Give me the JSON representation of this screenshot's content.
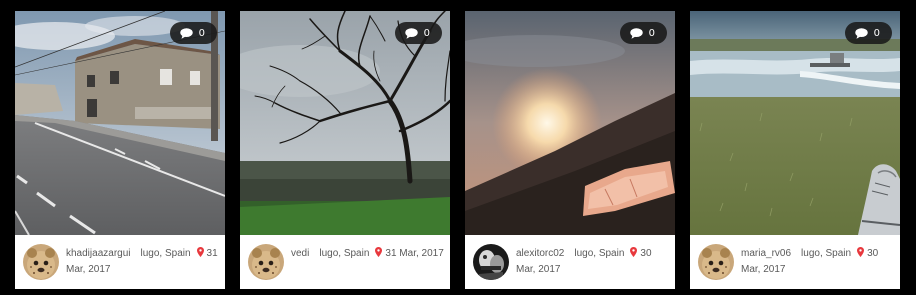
{
  "accent_color": "#e8383d",
  "posts": [
    {
      "comments": "0",
      "username": "khadijaazargui",
      "location": "lugo, Spain",
      "date": "31 Mar, 2017",
      "avatar": "cheetah-cub",
      "photo": "street with houses"
    },
    {
      "comments": "0",
      "username": "vedi",
      "location": "lugo, Spain",
      "date": "31 Mar, 2017",
      "avatar": "cheetah-cub",
      "photo": "bare tree over valley"
    },
    {
      "comments": "0",
      "username": "alexitorc02",
      "location": "lugo, Spain",
      "date": "30 Mar, 2017",
      "avatar": "monochrome-figure",
      "photo": "sunset over hills"
    },
    {
      "comments": "0",
      "username": "maria_rv06",
      "location": "lugo, Spain",
      "date": "30 Mar, 2017",
      "avatar": "cheetah-cub",
      "photo": "river by grass field"
    }
  ]
}
